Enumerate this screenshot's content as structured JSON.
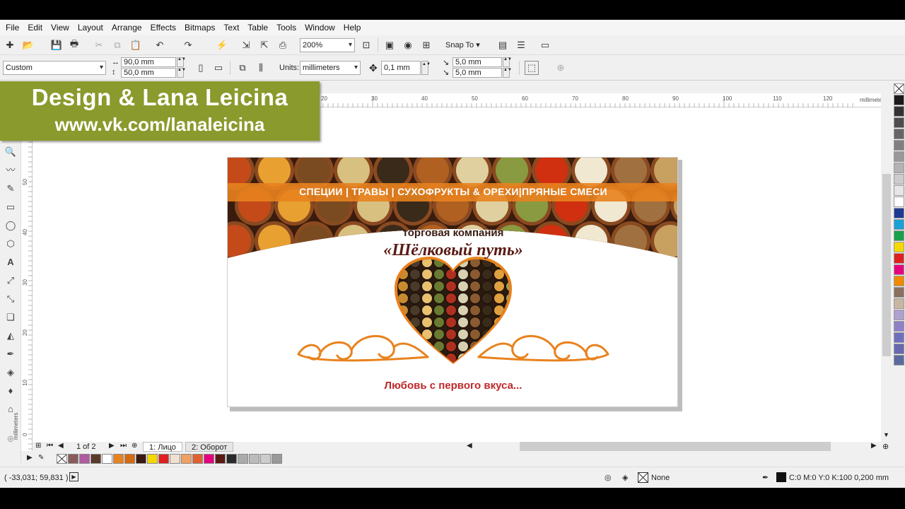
{
  "menu": [
    "File",
    "Edit",
    "View",
    "Layout",
    "Arrange",
    "Effects",
    "Bitmaps",
    "Text",
    "Table",
    "Tools",
    "Window",
    "Help"
  ],
  "toolbar": {
    "zoom": "200%",
    "snap_to": "Snap To"
  },
  "property_bar": {
    "page_preset": "Custom",
    "width": "90,0 mm",
    "height": "50,0 mm",
    "units_label": "Units:",
    "units_value": "millimeters",
    "nudge": "0,1 mm",
    "dup_x": "5,0 mm",
    "dup_y": "5,0 mm"
  },
  "watermark": {
    "line1": "Design & Lana Leicina",
    "line2": "www.vk.com/lanaleicina"
  },
  "ruler": {
    "h_labels": [
      "20",
      "30",
      "40",
      "50",
      "60",
      "70",
      "80",
      "90",
      "100",
      "110",
      "120"
    ],
    "h_unit": "millimeters",
    "v_labels": [
      "50",
      "40",
      "30",
      "20",
      "10",
      "0"
    ],
    "v_unit": "millimeters"
  },
  "card": {
    "banner_text": "СПЕЦИИ | ТРАВЫ | СУХОФРУКТЫ & ОРЕХИ|ПРЯНЫЕ СМЕСИ",
    "company_label": "торговая компания",
    "company_name": "«Шёлковый путь»",
    "slogan": "Любовь с первого вкуса...",
    "colors": {
      "orange": "#e8821e",
      "dark_red": "#5a1a14",
      "slogan_red": "#c0282a"
    }
  },
  "pages": {
    "counter": "1 of 2",
    "tabs": [
      "1: Лицо",
      "2: Оборот"
    ]
  },
  "palette_colors": [
    "#1a1a1a",
    "#333333",
    "#4d4d4d",
    "#666666",
    "#808080",
    "#999999",
    "#b3b3b3",
    "#cccccc",
    "#e6e6e6",
    "#ffffff",
    "#1f3a93",
    "#1aa1d6",
    "#18a04a",
    "#f5d800",
    "#e02020",
    "#e5007e",
    "#f08a00",
    "#8a7060",
    "#c8b6a0",
    "#b0a0d0",
    "#9080c8",
    "#6f6fc0",
    "#6868b0",
    "#5a6aa0"
  ],
  "doc_palette": [
    "#8a5a5a",
    "#b05aa0",
    "#5a3a2a",
    "#ffffff",
    "#e8821e",
    "#d66a10",
    "#3a1a10",
    "#f5d800",
    "#e02020",
    "#f0e0d0",
    "#f0a060",
    "#e06030",
    "#e5007e",
    "#5a1a14",
    "#2a2a2a",
    "#aaaaaa",
    "#bbbbbb",
    "#cccccc",
    "#999999"
  ],
  "status": {
    "coords": "( -33,031; 59,831 )",
    "fill": "None",
    "outline": "C:0 M:0 Y:0 K:100  0,200 mm"
  }
}
